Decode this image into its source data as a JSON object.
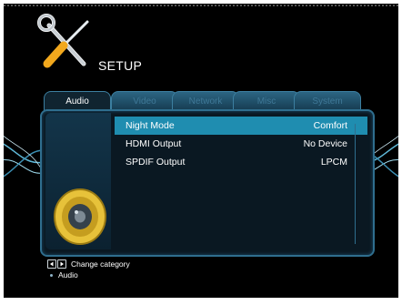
{
  "header": {
    "title": "SETUP"
  },
  "tabs": [
    {
      "label": "Audio"
    },
    {
      "label": "Video"
    },
    {
      "label": "Network"
    },
    {
      "label": "Misc"
    },
    {
      "label": "System"
    }
  ],
  "settings": [
    {
      "label": "Night Mode",
      "value": "Comfort"
    },
    {
      "label": "HDMI Output",
      "value": "No Device"
    },
    {
      "label": "SPDIF Output",
      "value": "LPCM"
    }
  ],
  "footer": {
    "change_category": "Change category",
    "current_category": "Audio"
  },
  "colors": {
    "accent": "#1f8db0",
    "panel_border": "#2f6e8e",
    "background": "#000000"
  },
  "icons": {
    "logo": "wrench-screwdriver-icon",
    "category": "speaker-icon",
    "nav_left": "arrow-left-icon",
    "nav_right": "arrow-right-icon"
  }
}
